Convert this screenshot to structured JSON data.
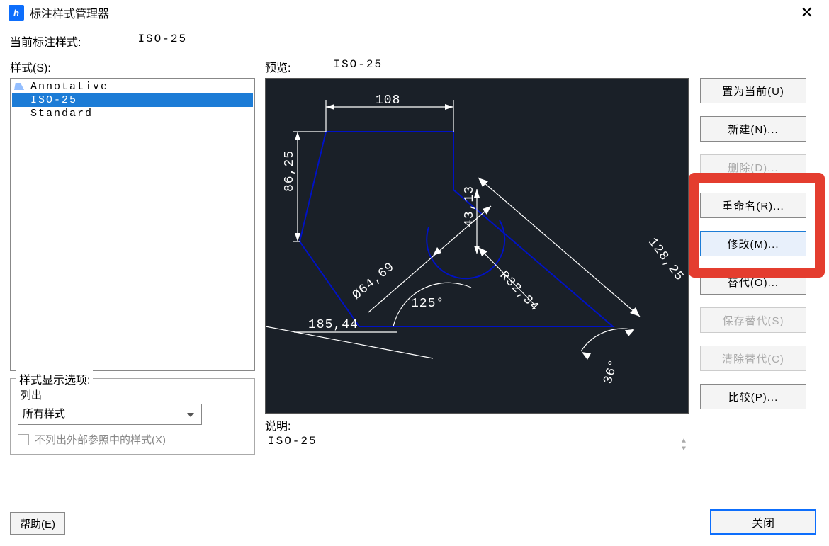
{
  "window": {
    "title": "标注样式管理器"
  },
  "current": {
    "label": "当前标注样式:",
    "value": "ISO-25"
  },
  "styles": {
    "label": "样式(S):",
    "items": [
      {
        "name": "Annotative",
        "selected": false,
        "annot": true
      },
      {
        "name": "ISO-25",
        "selected": true,
        "annot": false
      },
      {
        "name": "Standard",
        "selected": false,
        "annot": false
      }
    ]
  },
  "display_options": {
    "group_label": "样式显示选项:",
    "list_label": "列出",
    "dropdown_value": "所有样式",
    "checkbox_label": "不列出外部参照中的样式(X)"
  },
  "preview": {
    "label": "预览:",
    "style": "ISO-25",
    "dims": {
      "top": "108",
      "left": "86,25",
      "radius_inner": "43,13",
      "diameter": "Ø64,69",
      "radius_outer": "R32,34",
      "angle": "125°",
      "bottom": "185,44",
      "slant": "128,25",
      "arc": "36°"
    }
  },
  "description": {
    "label": "说明:",
    "value": "ISO-25"
  },
  "buttons": {
    "set_current": "置为当前(U)",
    "new": "新建(N)...",
    "delete": "删除(D)...",
    "rename": "重命名(R)...",
    "modify": "修改(M)...",
    "override": "替代(O)...",
    "save_override": "保存替代(S)",
    "clear_override": "清除替代(C)",
    "compare": "比较(P)...",
    "help": "帮助(E)",
    "close": "关闭"
  }
}
